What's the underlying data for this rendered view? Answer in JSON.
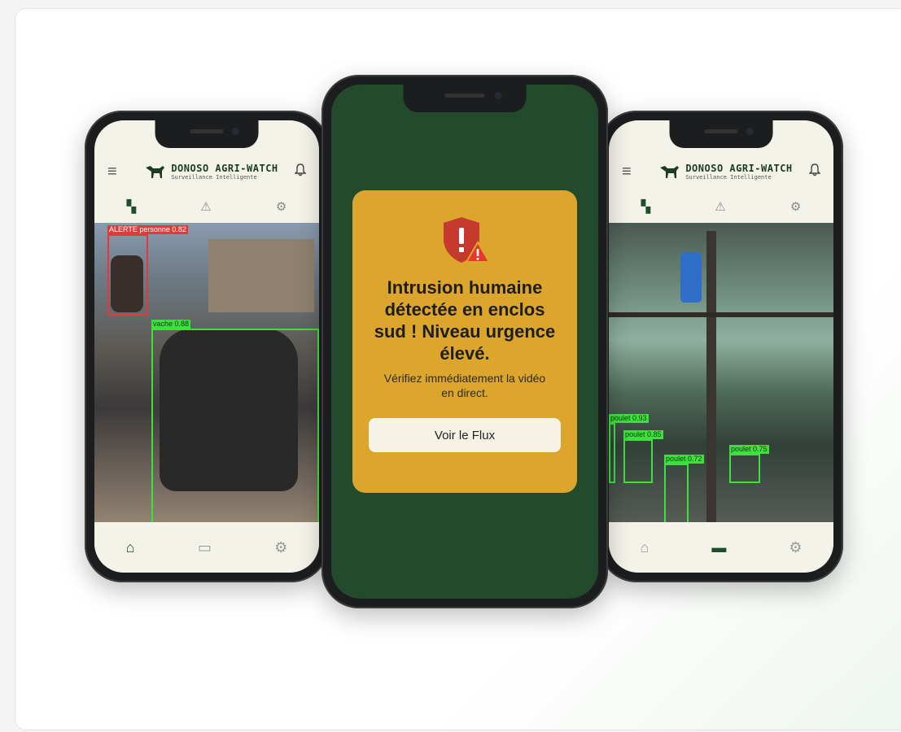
{
  "brand": {
    "name": "DONOSO AGRI-WATCH",
    "subtitle": "Surveillance Intelligente"
  },
  "left_phone": {
    "detections": [
      {
        "label": "ALERTE personne 0.82",
        "color": "red"
      },
      {
        "label": "vache 0.88",
        "color": "green"
      }
    ]
  },
  "right_phone": {
    "detections": [
      {
        "label": "poulet 0.93"
      },
      {
        "label": "poulet 0.85"
      },
      {
        "label": "poulet 0.72"
      },
      {
        "label": "poulet 0.75"
      }
    ]
  },
  "alert": {
    "title": "Intrusion humaine détectée en enclos sud ! Niveau urgence élevé.",
    "description": "Vérifiez immédiatement la vidéo en direct.",
    "button_label": "Voir le Flux"
  },
  "colors": {
    "brand_green": "#234b2b",
    "alert_amber": "#dca62c",
    "detection_green": "#3ee03e",
    "detection_red": "#e23a3a"
  },
  "icons": [
    "menu-icon",
    "bell-icon",
    "dashboard-icon",
    "warning-icon",
    "settings-icon",
    "home-icon",
    "video-icon",
    "shield-alert-icon"
  ]
}
